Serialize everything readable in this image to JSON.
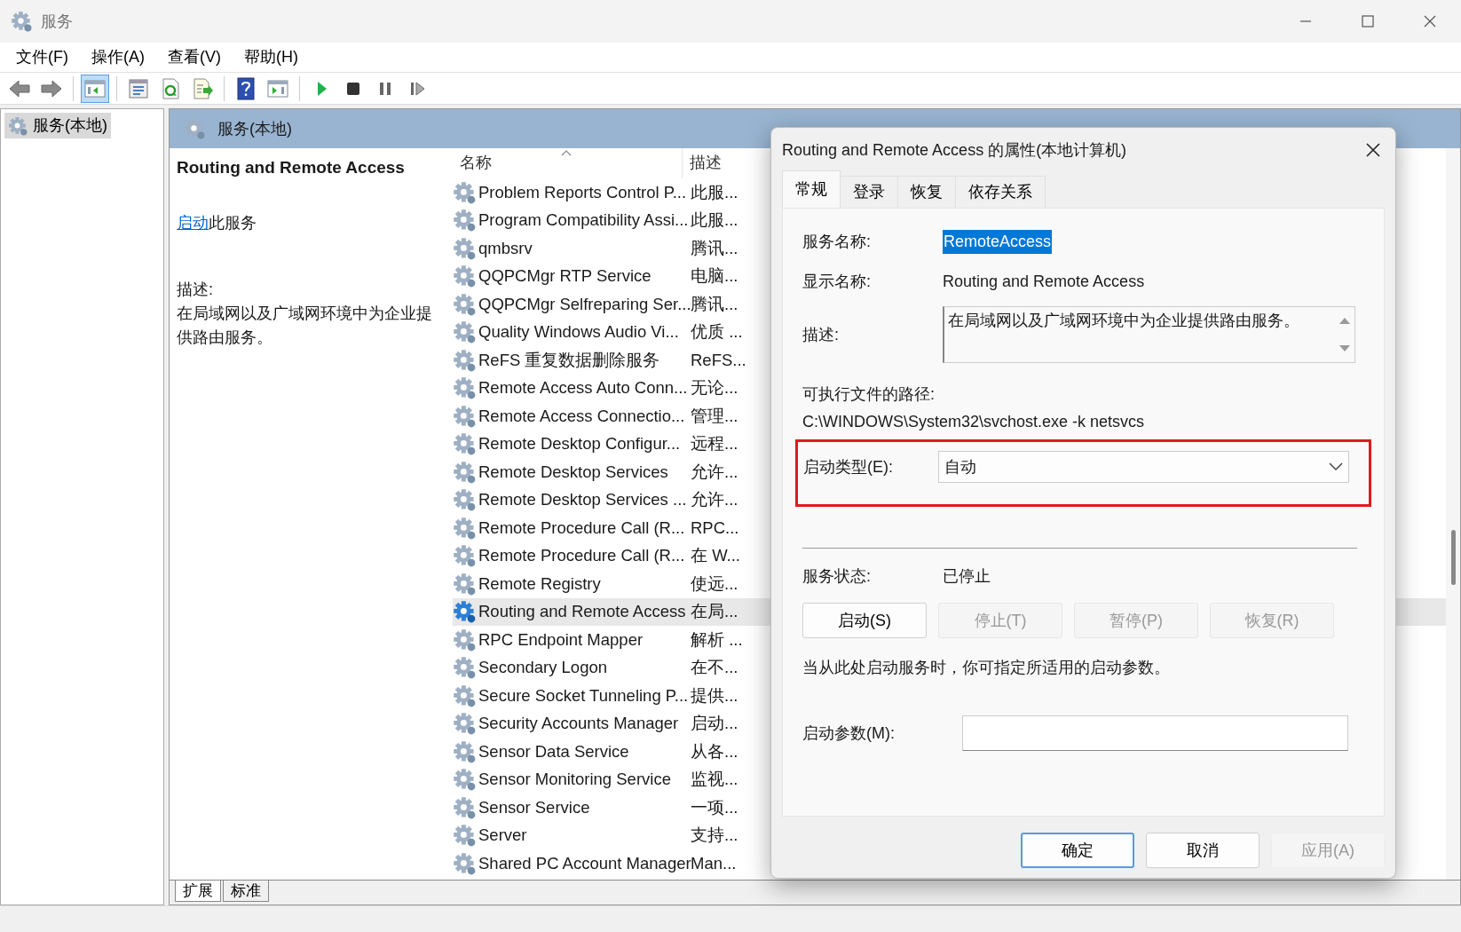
{
  "window": {
    "title": "服务"
  },
  "menu": [
    "文件(F)",
    "操作(A)",
    "查看(V)",
    "帮助(H)"
  ],
  "toolbar": [
    [
      {
        "kind": "back",
        "selected": false
      },
      {
        "kind": "forward",
        "selected": false
      }
    ],
    [
      {
        "kind": "tree",
        "selected": true
      }
    ],
    [
      {
        "kind": "properties",
        "selected": false
      },
      {
        "kind": "refresh",
        "selected": false
      },
      {
        "kind": "export",
        "selected": false
      }
    ],
    [
      {
        "kind": "help",
        "selected": false
      },
      {
        "kind": "pane",
        "selected": false
      }
    ],
    [
      {
        "kind": "play",
        "selected": false
      },
      {
        "kind": "stop",
        "selected": false
      },
      {
        "kind": "pause",
        "selected": false
      },
      {
        "kind": "resume",
        "selected": false
      }
    ]
  ],
  "tree": [
    {
      "label": "服务(本地)",
      "selected": true
    }
  ],
  "pane_header": {
    "title": "服务(本地)"
  },
  "details": {
    "service_name": "Routing and Remote Access",
    "start_link": "启动",
    "start_suffix": "此服务",
    "description_label": "描述:",
    "description": "在局域网以及广域网环境中为企业提供路由服务。"
  },
  "table": {
    "columns": [
      {
        "label": "名称",
        "sorted": true
      },
      {
        "label": "描述"
      }
    ],
    "rows": [
      {
        "name": "Problem Reports Control P...",
        "description": "此服...",
        "selected": false
      },
      {
        "name": "Program Compatibility Assi...",
        "description": "此服...",
        "selected": false
      },
      {
        "name": "qmbsrv",
        "description": "腾讯...",
        "selected": false
      },
      {
        "name": "QQPCMgr RTP Service",
        "description": "电脑...",
        "selected": false
      },
      {
        "name": "QQPCMgr Selfreparing Ser...",
        "description": "腾讯...",
        "selected": false
      },
      {
        "name": "Quality Windows Audio Vi...",
        "description": "优质 ...",
        "selected": false
      },
      {
        "name": "ReFS 重复数据删除服务",
        "description": "ReFS...",
        "selected": false
      },
      {
        "name": "Remote Access Auto Conn...",
        "description": "无论...",
        "selected": false
      },
      {
        "name": "Remote Access Connectio...",
        "description": "管理...",
        "selected": false
      },
      {
        "name": "Remote Desktop Configur...",
        "description": "远程...",
        "selected": false
      },
      {
        "name": "Remote Desktop Services",
        "description": "允许...",
        "selected": false
      },
      {
        "name": "Remote Desktop Services ...",
        "description": "允许...",
        "selected": false
      },
      {
        "name": "Remote Procedure Call (R...",
        "description": "RPC...",
        "selected": false
      },
      {
        "name": "Remote Procedure Call (R...",
        "description": "在 W...",
        "selected": false
      },
      {
        "name": "Remote Registry",
        "description": "使远...",
        "selected": false
      },
      {
        "name": "Routing and Remote Access",
        "description": "在局...",
        "selected": true
      },
      {
        "name": "RPC Endpoint Mapper",
        "description": "解析 ...",
        "selected": false
      },
      {
        "name": "Secondary Logon",
        "description": "在不...",
        "selected": false
      },
      {
        "name": "Secure Socket Tunneling P...",
        "description": "提供...",
        "selected": false
      },
      {
        "name": "Security Accounts Manager",
        "description": "启动...",
        "selected": false
      },
      {
        "name": "Sensor Data Service",
        "description": "从各...",
        "selected": false
      },
      {
        "name": "Sensor Monitoring Service",
        "description": "监视...",
        "selected": false
      },
      {
        "name": "Sensor Service",
        "description": "一项...",
        "selected": false
      },
      {
        "name": "Server",
        "description": "支持...",
        "selected": false
      },
      {
        "name": "Shared PC Account Manager",
        "description": "Man...",
        "selected": false
      }
    ]
  },
  "view_tabs": [
    {
      "label": "扩展",
      "selected": true
    },
    {
      "label": "标准",
      "selected": false
    }
  ],
  "dialog": {
    "title": "Routing and Remote Access 的属性(本地计算机)",
    "tabs": [
      {
        "label": "常规",
        "selected": true
      },
      {
        "label": "登录",
        "selected": false
      },
      {
        "label": "恢复",
        "selected": false
      },
      {
        "label": "依存关系",
        "selected": false
      }
    ],
    "service_name_label": "服务名称:",
    "service_name": "RemoteAccess",
    "display_name_label": "显示名称:",
    "display_name": "Routing and Remote Access",
    "description_label": "描述:",
    "description": "在局域网以及广域网环境中为企业提供路由服务。",
    "path_label": "可执行文件的路径:",
    "path": "C:\\WINDOWS\\System32\\svchost.exe -k netsvcs",
    "startup_type_label": "启动类型(E):",
    "startup_type": "自动",
    "startup_highlighted": true,
    "status_label": "服务状态:",
    "status": "已停止",
    "service_buttons": [
      {
        "label": "启动(S)",
        "disabled": false
      },
      {
        "label": "停止(T)",
        "disabled": true
      },
      {
        "label": "暂停(P)",
        "disabled": true
      },
      {
        "label": "恢复(R)",
        "disabled": true
      }
    ],
    "hint": "当从此处启动服务时，你可指定所适用的启动参数。",
    "params_label": "启动参数(M):",
    "buttons": [
      {
        "label": "确定",
        "disabled": false,
        "default": true
      },
      {
        "label": "取消",
        "disabled": false,
        "default": false
      },
      {
        "label": "应用(A)",
        "disabled": true,
        "default": false
      }
    ]
  }
}
